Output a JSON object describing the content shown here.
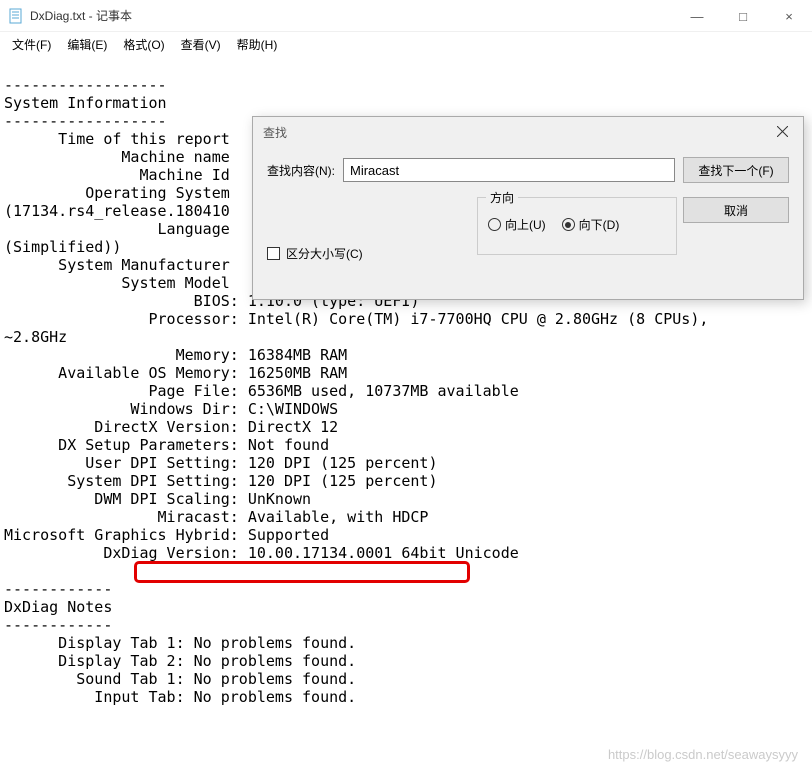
{
  "window": {
    "title": "DxDiag.txt - 记事本",
    "controls": {
      "min": "—",
      "max": "□",
      "close": "×"
    }
  },
  "menu": {
    "file": "文件(F)",
    "edit": "编辑(E)",
    "format": "格式(O)",
    "view": "查看(V)",
    "help": "帮助(H)"
  },
  "text": {
    "l1": "------------------",
    "l2": "System Information",
    "l3": "------------------",
    "l4": "      Time of this report",
    "l5": "             Machine name",
    "l6": "               Machine Id",
    "l7": "         Operating System",
    "l8": "(17134.rs4_release.180410",
    "l9": "                 Language",
    "l10": "(Simplified))",
    "l11": "      System Manufacturer",
    "l12": "             System Model",
    "l13": "                     BIOS: 1.10.0 (type: UEFI)",
    "l14": "                Processor: Intel(R) Core(TM) i7-7700HQ CPU @ 2.80GHz (8 CPUs),",
    "l15": "~2.8GHz",
    "l16": "                   Memory: 16384MB RAM",
    "l17": "      Available OS Memory: 16250MB RAM",
    "l18": "                Page File: 6536MB used, 10737MB available",
    "l19": "              Windows Dir: C:\\WINDOWS",
    "l20": "          DirectX Version: DirectX 12",
    "l21": "      DX Setup Parameters: Not found",
    "l22": "         User DPI Setting: 120 DPI (125 percent)",
    "l23": "       System DPI Setting: 120 DPI (125 percent)",
    "l24": "          DWM DPI Scaling: UnKnown",
    "l25": "                 Miracast: Available, with HDCP",
    "l26": "Microsoft Graphics Hybrid: Supported",
    "l27": "           DxDiag Version: 10.00.17134.0001 64bit Unicode",
    "l28": "",
    "l29": "------------",
    "l30": "DxDiag Notes",
    "l31": "------------",
    "l32": "      Display Tab 1: No problems found.",
    "l33": "      Display Tab 2: No problems found.",
    "l34": "        Sound Tab 1: No problems found.",
    "l35": "          Input Tab: No problems found."
  },
  "find": {
    "title": "查找",
    "content_label": "查找内容(N):",
    "value": "Miracast",
    "next_btn": "查找下一个(F)",
    "cancel_btn": "取消",
    "direction_label": "方向",
    "up": "向上(U)",
    "down": "向下(D)",
    "match_case": "区分大小写(C)"
  },
  "watermark": "https://blog.csdn.net/seawaysyyy"
}
